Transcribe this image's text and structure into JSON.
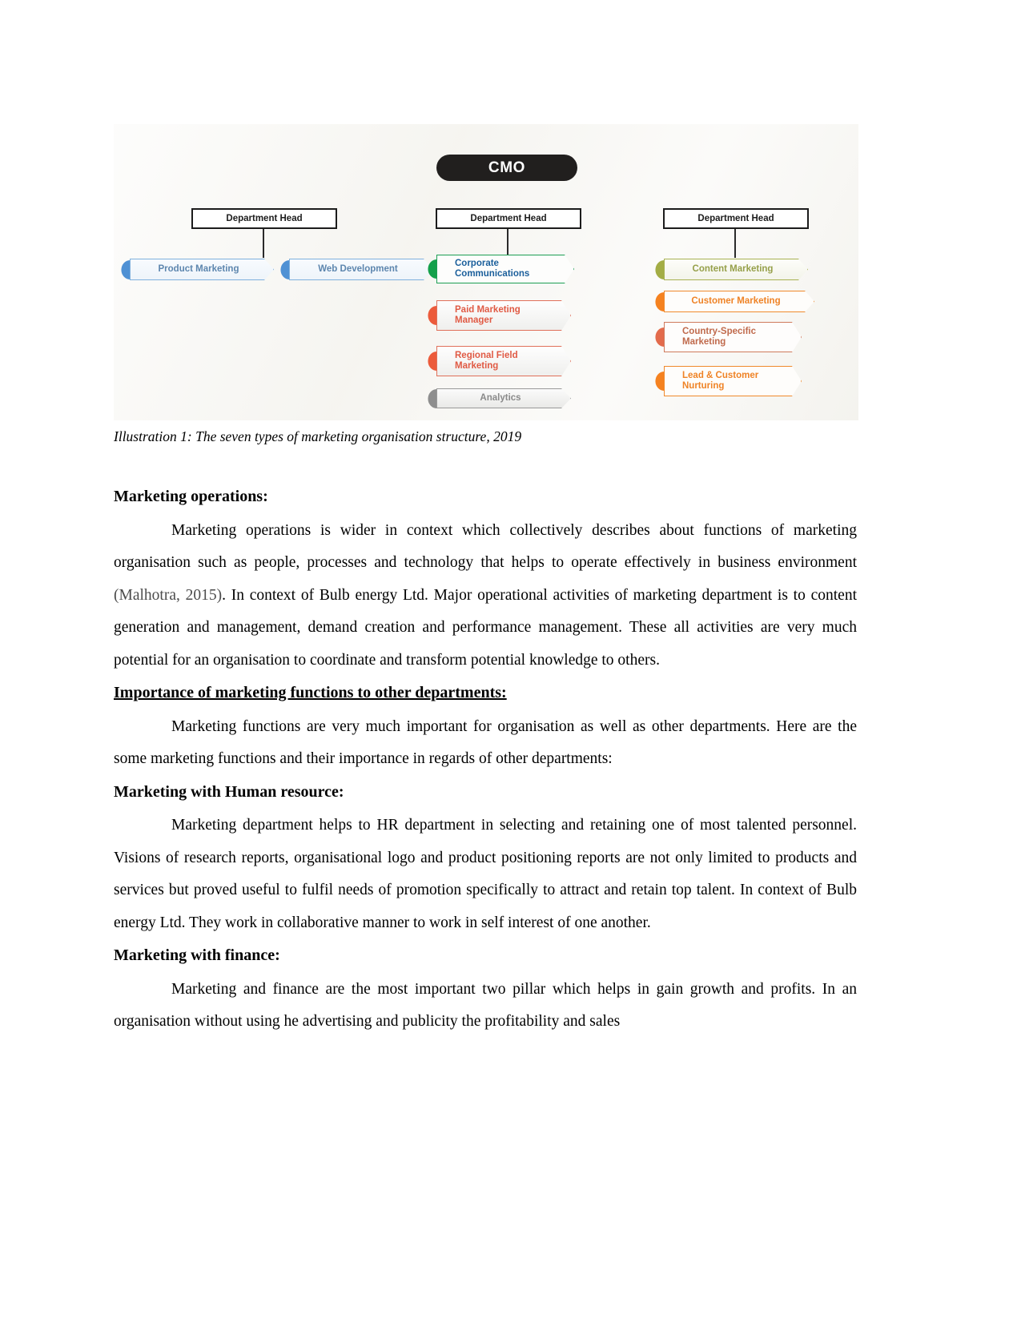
{
  "figure": {
    "caption": "Illustration 1: The seven types of marketing organisation structure, 2019",
    "root": {
      "label": "CMO"
    },
    "columns": [
      {
        "dept_head": "Department Head",
        "nodes": [
          {
            "label": "Product Marketing",
            "color": "#4f91d4"
          },
          {
            "label": "Web Development",
            "color": "#4f91d4"
          }
        ]
      },
      {
        "dept_head": "Department Head",
        "nodes": [
          {
            "label": "Corporate Communications",
            "color": "#14a04b"
          },
          {
            "label": "Paid Marketing Manager",
            "color": "#ec5b3b"
          },
          {
            "label": "Regional Field Marketing",
            "color": "#ec5b3b"
          },
          {
            "label": "Analytics",
            "color": "#8e8e8e"
          }
        ]
      },
      {
        "dept_head": "Department Head",
        "nodes": [
          {
            "label": "Content Marketing",
            "color": "#a3ad45"
          },
          {
            "label": "Customer Marketing",
            "color": "#f58220"
          },
          {
            "label": "Country-Specific Marketing",
            "color": "#e36b4c"
          },
          {
            "label": "Lead & Customer Nurturing",
            "color": "#f58220"
          }
        ]
      }
    ],
    "node_labels": {
      "product_marketing": "Product Marketing",
      "web_development": "Web Development",
      "corporate_communications_l1": "Corporate",
      "corporate_communications_l2": "Communications",
      "paid_marketing_l1": "Paid Marketing",
      "paid_marketing_l2": "Manager",
      "regional_field_l1": "Regional Field",
      "regional_field_l2": "Marketing",
      "analytics": "Analytics",
      "content_marketing": "Content Marketing",
      "customer_marketing": "Customer Marketing",
      "country_specific_l1": "Country-Specific",
      "country_specific_l2": "Marketing",
      "lead_nurturing_l1": "Lead & Customer",
      "lead_nurturing_l2": "Nurturing"
    }
  },
  "document": {
    "heading_marketing_operations": "Marketing operations:",
    "para_marketing_operations_a": "Marketing operations is wider in context which collectively describes about functions of marketing organisation such as people, processes and technology that helps to operate effectively in business environment ",
    "citation_malhotra": "(Malhotra,  2015)",
    "para_marketing_operations_b": ". In context of Bulb energy Ltd. Major operational activities of marketing department is to content generation and management, demand creation and performance management. These all activities are very much potential for an organisation to coordinate and transform potential knowledge to others.",
    "heading_importance": "Importance of marketing functions to other departments:",
    "para_importance": "Marketing functions are very much important for organisation as well as other departments. Here are the some marketing functions and their importance in regards of other departments:",
    "heading_hr": "Marketing with Human resource:",
    "para_hr": "Marketing department helps to HR department in selecting and retaining one of most talented personnel. Visions of research reports, organisational logo and product positioning reports are not only limited to products and services but proved useful to fulfil needs of promotion specifically to attract and retain top talent. In context of Bulb energy Ltd. They work in collaborative manner to work in self interest of one another.",
    "heading_finance": "Marketing with finance:",
    "para_finance": "Marketing and finance are the most important two pillar which helps in gain growth and profits. In an organisation without using he advertising and publicity the profitability and sales"
  }
}
